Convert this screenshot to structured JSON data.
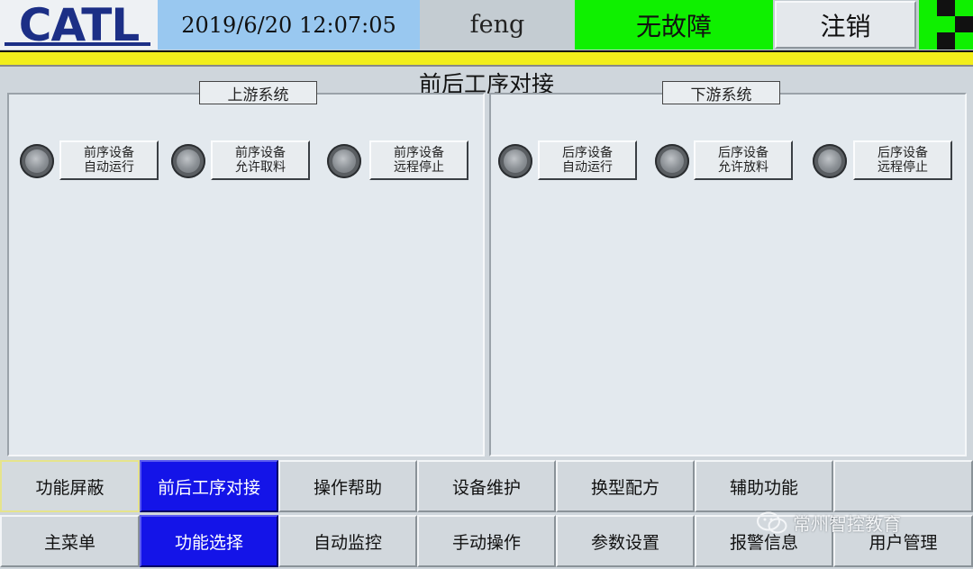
{
  "header": {
    "logo": "CATL",
    "datetime": "2019/6/20  12:07:05",
    "user": "feng",
    "fault_status": "无故障",
    "logout_label": "注销"
  },
  "page": {
    "title": "前后工序对接"
  },
  "upstream": {
    "title": "上游系统",
    "signals": [
      {
        "line1": "前序设备",
        "line2": "自动运行"
      },
      {
        "line1": "前序设备",
        "line2": "允许取料"
      },
      {
        "line1": "前序设备",
        "line2": "远程停止"
      }
    ]
  },
  "downstream": {
    "title": "下游系统",
    "signals": [
      {
        "line1": "后序设备",
        "line2": "自动运行"
      },
      {
        "line1": "后序设备",
        "line2": "允许放料"
      },
      {
        "line1": "后序设备",
        "line2": "远程停止"
      }
    ]
  },
  "nav": {
    "row1": [
      "功能屏蔽",
      "前后工序对接",
      "操作帮助",
      "设备维护",
      "换型配方",
      "辅助功能",
      ""
    ],
    "row2": [
      "主菜单",
      "功能选择",
      "自动监控",
      "手动操作",
      "参数设置",
      "报警信息",
      "用户管理"
    ]
  },
  "watermark": {
    "text": "常州智控教育",
    "icon": "wechat-icon"
  },
  "colors": {
    "fault_ok": "#0ff000",
    "active_nav": "#1414e8",
    "datetime_bg": "#99c8f0",
    "alarm_bar": "#f2ee1b"
  }
}
